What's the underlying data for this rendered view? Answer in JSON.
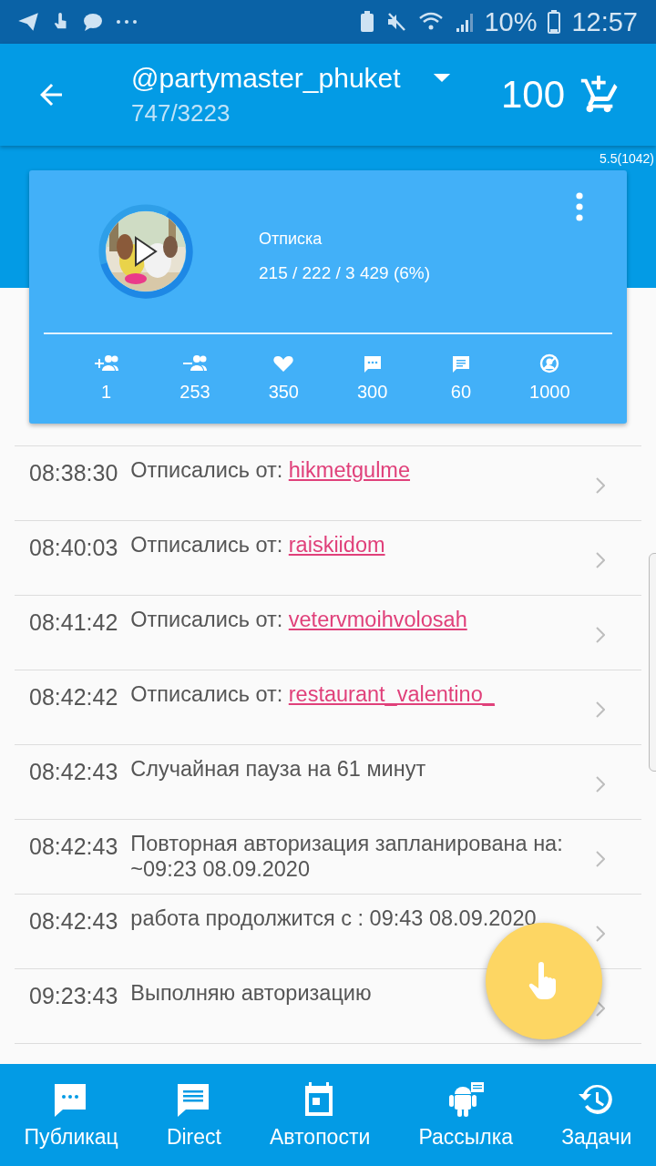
{
  "status_bar": {
    "battery": "10%",
    "time": "12:57"
  },
  "header": {
    "account": "@partymaster_phuket",
    "counter": "747/3223",
    "balance": "100"
  },
  "version": "5.5(1042)",
  "card": {
    "title": "Отписка",
    "stats_line": "215 / 222 / 3 429 (6%)",
    "stats": [
      {
        "kind": "follow",
        "value": "1"
      },
      {
        "kind": "unfollow",
        "value": "253"
      },
      {
        "kind": "like",
        "value": "350"
      },
      {
        "kind": "comment",
        "value": "300"
      },
      {
        "kind": "message",
        "value": "60"
      },
      {
        "kind": "limit",
        "value": "1000"
      }
    ]
  },
  "log": [
    {
      "time": "08:38:30",
      "text": "Отписались от:",
      "user": "hikmetgulme"
    },
    {
      "time": "08:40:03",
      "text": "Отписались от:",
      "user": "raiskiidom"
    },
    {
      "time": "08:41:42",
      "text": "Отписались от:",
      "user": "vetervmoihvolosah"
    },
    {
      "time": "08:42:42",
      "text": "Отписались от:",
      "user": "restaurant_valentino_"
    },
    {
      "time": "08:42:43",
      "text": "Случайная пауза на 61 минут"
    },
    {
      "time": "08:42:43",
      "text": "Повторная авторизация запланирована на: ~09:23 08.09.2020"
    },
    {
      "time": "08:42:43",
      "text": "работа продолжится с : 09:43 08.09.2020"
    },
    {
      "time": "09:23:43",
      "text": "Выполняю авторизацию"
    }
  ],
  "bottom_nav": [
    {
      "kind": "posts",
      "label": "Публикац"
    },
    {
      "kind": "direct",
      "label": "Direct"
    },
    {
      "kind": "autopost",
      "label": "Автопости"
    },
    {
      "kind": "mailing",
      "label": "Рассылка"
    },
    {
      "kind": "tasks",
      "label": "Задачи"
    }
  ]
}
